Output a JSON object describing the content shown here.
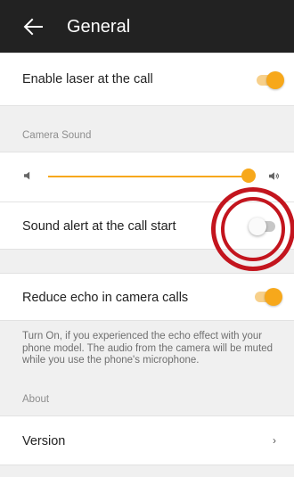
{
  "header": {
    "title": "General",
    "back_icon": "arrow-left-icon"
  },
  "settings": {
    "laser": {
      "label": "Enable laser at the call",
      "enabled": true
    },
    "camera_sound_section": "Camera Sound",
    "volume": {
      "level": 0.97,
      "low_icon": "volume-low-icon",
      "high_icon": "volume-high-icon"
    },
    "sound_alert": {
      "label": "Sound alert at the call start",
      "enabled": false
    },
    "echo": {
      "label": "Reduce echo in camera calls",
      "enabled": true,
      "description": "Turn On, if you experienced the echo effect with your phone model. The audio from the camera will be muted while you use the phone's microphone."
    },
    "about_section": "About",
    "version": {
      "label": "Version",
      "chevron": "›"
    }
  },
  "colors": {
    "accent": "#f7a81b",
    "highlight": "#c3151e",
    "appbar": "#222222"
  }
}
